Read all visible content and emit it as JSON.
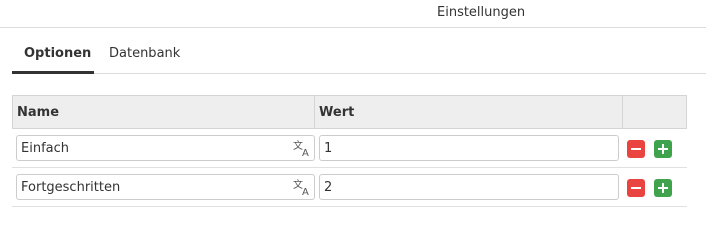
{
  "header": {
    "title": "Einstellungen"
  },
  "tabs": [
    {
      "label": "Optionen",
      "active": true
    },
    {
      "label": "Datenbank",
      "active": false
    }
  ],
  "table": {
    "columns": [
      "Name",
      "Wert",
      ""
    ],
    "rows": [
      {
        "name": "Einfach",
        "value": "1"
      },
      {
        "name": "Fortgeschritten",
        "value": "2"
      }
    ]
  },
  "icons": {
    "translate": "translate-icon",
    "remove": "minus-icon",
    "add": "plus-icon"
  },
  "colors": {
    "remove_button": "#e9443f",
    "add_button": "#3fa34d",
    "header_bg": "#eeeeee"
  }
}
